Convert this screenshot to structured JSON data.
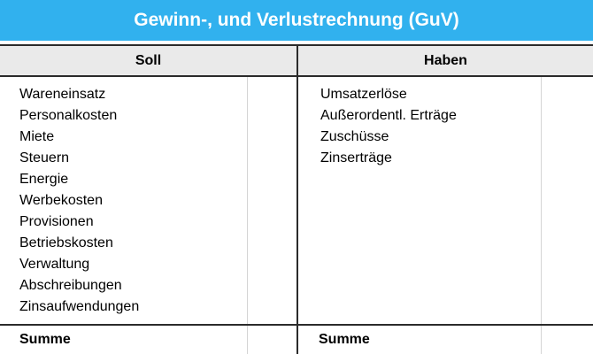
{
  "title": "Gewinn-, und Verlustrechnung (GuV)",
  "columns": {
    "soll": {
      "header": "Soll",
      "items": [
        "Wareneinsatz",
        "Personalkosten",
        "Miete",
        "Steuern",
        "Energie",
        "Werbekosten",
        "Provisionen",
        "Betriebskosten",
        "Verwaltung",
        "Abschreibungen",
        "Zinsaufwendungen"
      ],
      "sum_label": "Summe"
    },
    "haben": {
      "header": "Haben",
      "items": [
        "Umsatzerlöse",
        "Außerordentl. Erträge",
        "Zuschüsse",
        "Zinserträge"
      ],
      "sum_label": "Summe"
    }
  },
  "colors": {
    "title_bg": "#31b1ee",
    "title_text": "#ffffff",
    "header_bg": "#eaeaea",
    "rule": "#2b2b2b",
    "thin_rule": "#d4d4d4"
  }
}
